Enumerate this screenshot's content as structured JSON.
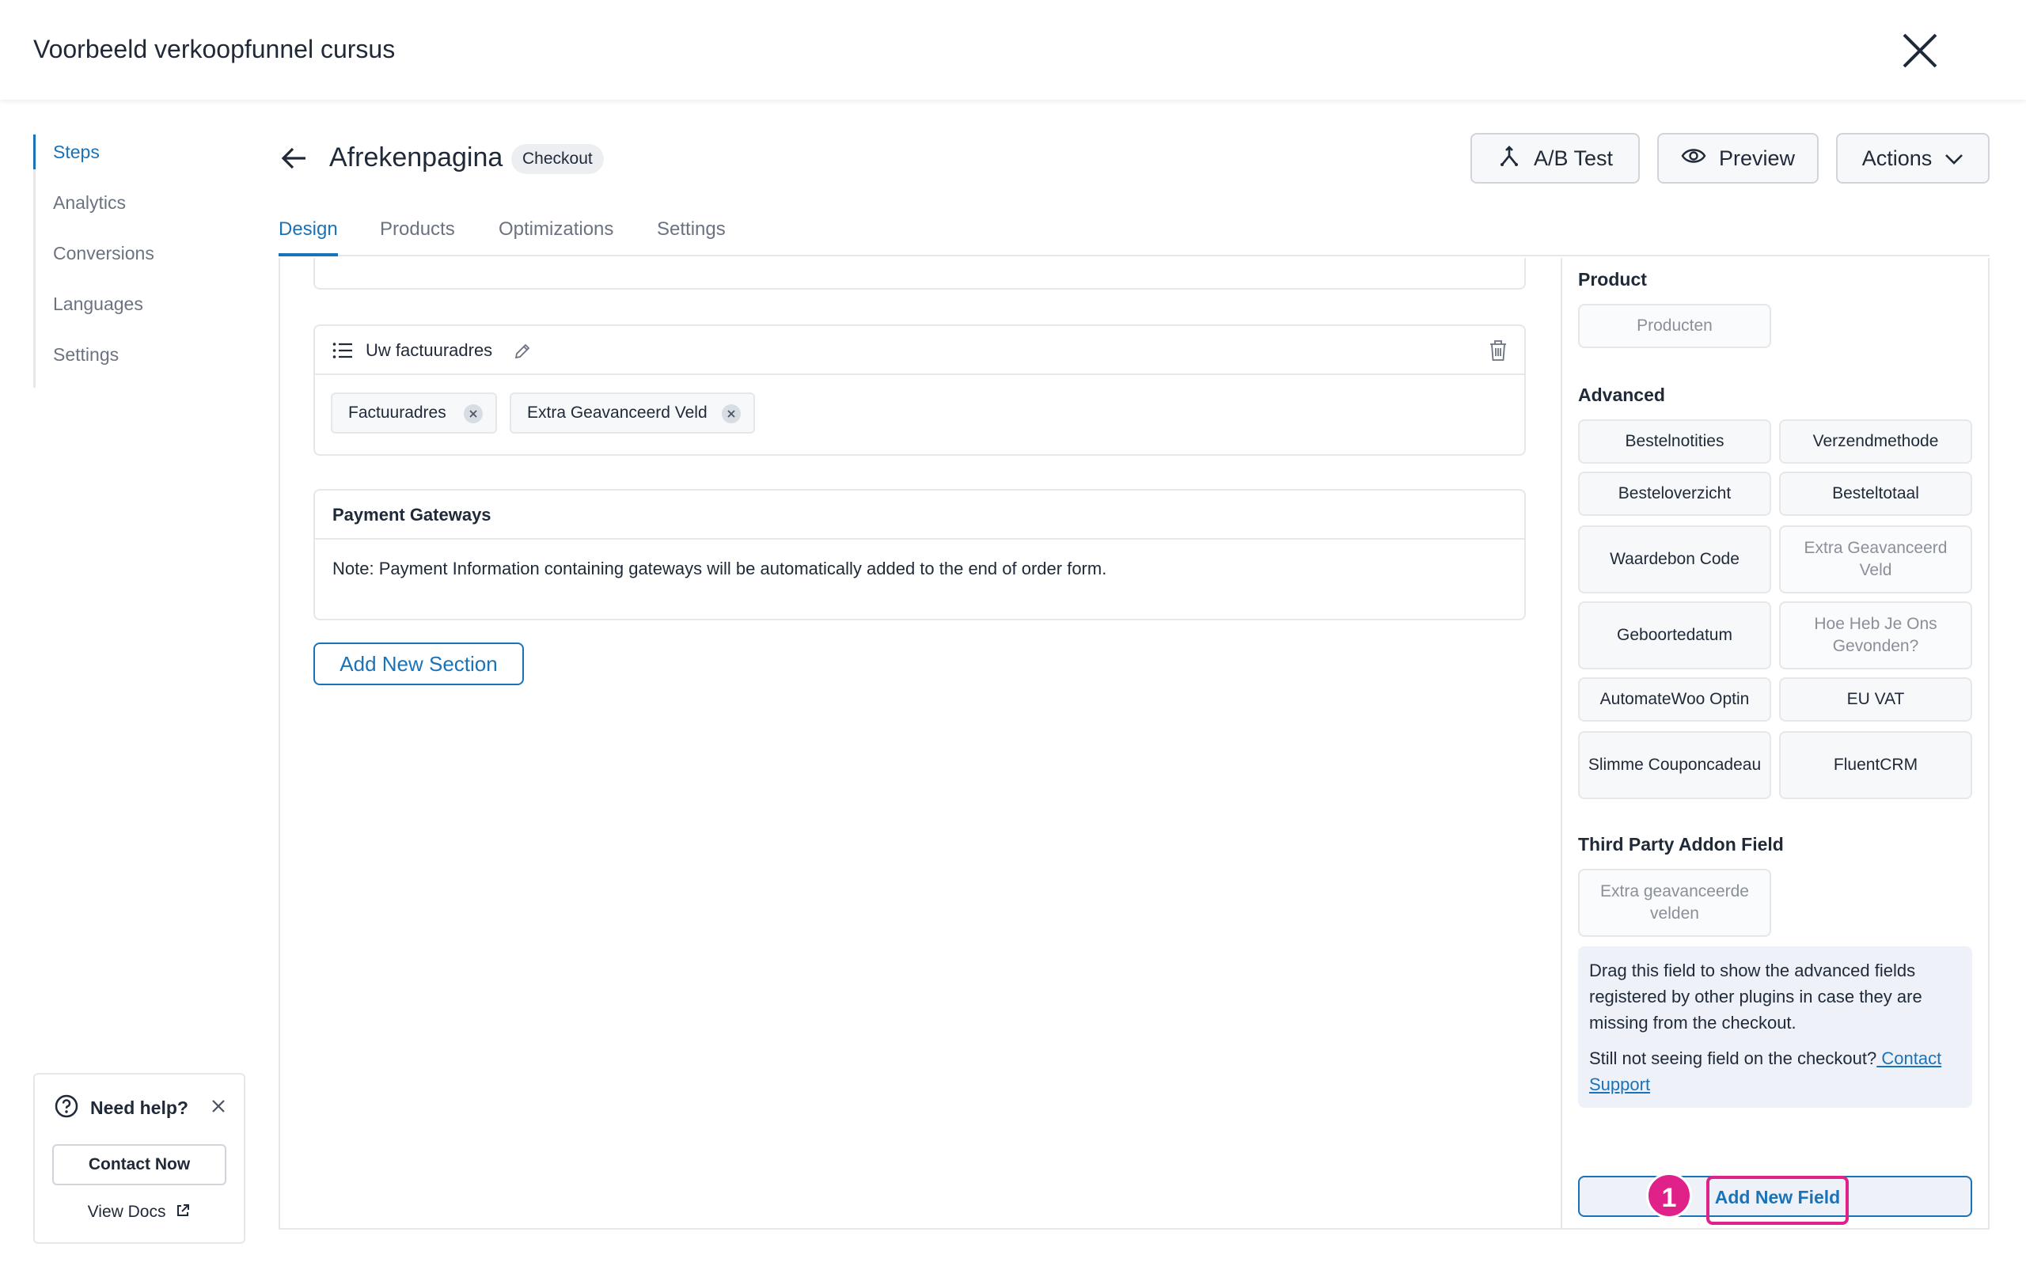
{
  "header": {
    "title": "Voorbeeld verkoopfunnel cursus"
  },
  "sidebar": {
    "items": [
      {
        "label": "Steps"
      },
      {
        "label": "Analytics"
      },
      {
        "label": "Conversions"
      },
      {
        "label": "Languages"
      },
      {
        "label": "Settings"
      }
    ]
  },
  "help": {
    "title": "Need help?",
    "contact_label": "Contact Now",
    "docs_label": "View Docs"
  },
  "step": {
    "title": "Afrekenpagina",
    "badge": "Checkout"
  },
  "toolbar": {
    "ab_test": "A/B Test",
    "preview": "Preview",
    "actions": "Actions"
  },
  "tabs": [
    {
      "label": "Design"
    },
    {
      "label": "Products"
    },
    {
      "label": "Optimizations"
    },
    {
      "label": "Settings"
    }
  ],
  "sections": {
    "billing": {
      "title": "Uw factuuradres",
      "chips": [
        {
          "label": "Factuuradres"
        },
        {
          "label": "Extra Geavanceerd Veld"
        }
      ]
    },
    "payment": {
      "title": "Payment Gateways",
      "note": "Note: Payment Information containing gateways will be automatically added to the end of order form."
    },
    "add_section_label": "Add New Section"
  },
  "right_panel": {
    "product_heading": "Product",
    "product_fields": [
      "Producten"
    ],
    "advanced_heading": "Advanced",
    "advanced_fields": [
      "Bestelnotities",
      "Verzendmethode",
      "Besteloverzicht",
      "Besteltotaal",
      "Waardebon Code",
      "Extra Geavanceerd Veld",
      "Geboortedatum",
      "Hoe Heb Je Ons Gevonden?",
      "AutomateWoo Optin",
      "EU VAT",
      "Slimme Couponcadeau",
      "FluentCRM"
    ],
    "third_party_heading": "Third Party Addon Field",
    "third_party_fields": [
      "Extra geavanceerde velden"
    ],
    "info_text": "Drag this field to show the advanced fields registered by other plugins in case they are missing from the checkout.",
    "info_question": "Still not seeing field on the checkout?",
    "info_link": " Contact Support",
    "add_field_label": "Add New Field",
    "marker": "1"
  },
  "colors": {
    "accent": "#1a73b8",
    "highlight": "#e0218a"
  }
}
